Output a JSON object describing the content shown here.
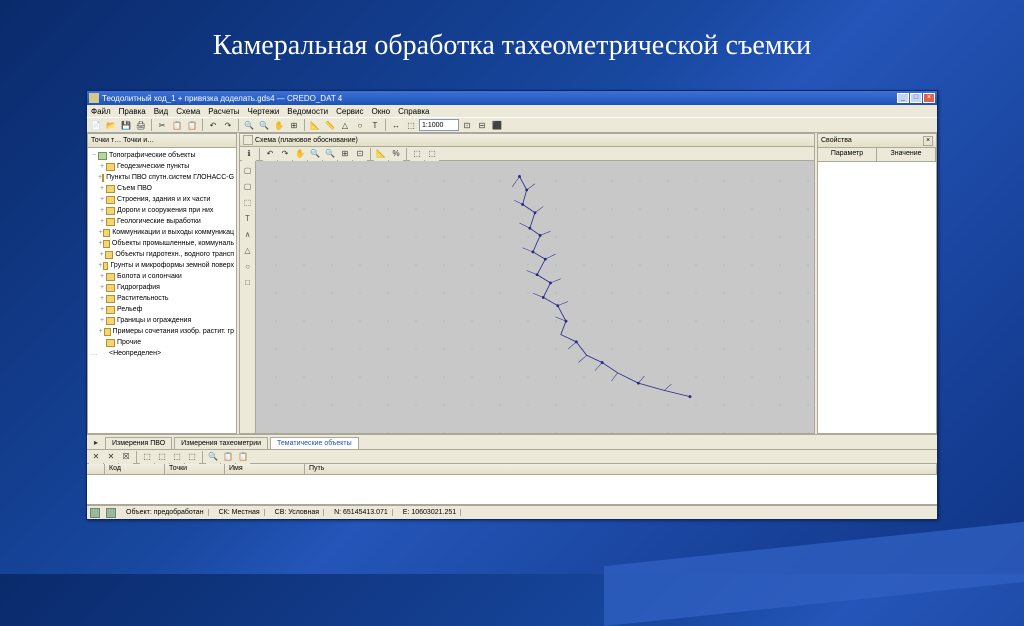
{
  "slide": {
    "title": "Камеральная обработка тахеометрической съемки"
  },
  "window": {
    "title": "Теодолитный ход_1 + привязка доделать.gds4 — CREDO_DAT 4",
    "buttons": {
      "min": "_",
      "max": "□",
      "close": "×"
    }
  },
  "menu": [
    "Файл",
    "Правка",
    "Вид",
    "Схема",
    "Расчеты",
    "Чертежи",
    "Ведомости",
    "Сервис",
    "Окно",
    "Справка"
  ],
  "toolbar": {
    "scale": "1:1000",
    "icons": [
      "📄",
      "📂",
      "💾",
      "🖨",
      "✂",
      "📋",
      "📋",
      "↶",
      "↷",
      "🔍",
      "🔍",
      "✋",
      "⊞",
      "📐",
      "📏",
      "△",
      "○",
      "T",
      "↔",
      "⬚",
      "⊡",
      "⊟",
      "⬛"
    ]
  },
  "leftPanel": {
    "title": "Точки т…   Точки и…",
    "root": "Топографические объекты",
    "items": [
      "Геодезические пункты",
      "Пункты ПВО спутн.систем ГЛОНАСС-G",
      "Съем ПВО",
      "Строения, здания и их части",
      "Дороги и сооружения при них",
      "Геологические выработки",
      "Коммуникации и выходы коммуникац",
      "Объекты промышленные, коммуналь",
      "Объекты гидротехн., водного трансп",
      "Грунты и микроформы земной поверх",
      "Болота и солончаки",
      "Гидрография",
      "Растительность",
      "Рельеф",
      "Границы и ограждения",
      "Примеры сочетания изобр. растит. гр",
      "Прочие"
    ],
    "last": "<Неопределен>"
  },
  "centerPanel": {
    "title": "Схема (плановое обоснование)",
    "toolIcons": [
      "ℹ",
      "↶",
      "↷",
      "✋",
      "🔍",
      "🔍",
      "⊞",
      "⊡",
      "📐",
      "%",
      "⬚",
      "⬚"
    ],
    "sideLabels": [
      "▢",
      "▢",
      "⬚",
      "T",
      "∧",
      "△",
      "○",
      "□"
    ]
  },
  "rightPanel": {
    "title": "Свойства",
    "col1": "Параметр",
    "col2": "Значение"
  },
  "bottomTabs": {
    "items": [
      "Измерения ПВО",
      "Измерения тахеометрии",
      "Тематические объекты"
    ],
    "activeIndex": 2
  },
  "bottomTools": [
    "✕",
    "✕",
    "☒",
    "⬚",
    "⬚",
    "⬚",
    "⬚",
    "🔍",
    "📋",
    "📋"
  ],
  "gridCols": {
    "c1": "",
    "c2": "Код",
    "c3": "Точки",
    "c4": "Имя",
    "c5": "Путь"
  },
  "status": {
    "obj": "Объект: предобработан",
    "sk": "СК: Местная",
    "sv": "СВ: Условная",
    "n": "N: 65145413.071",
    "e": "E: 10603021.251"
  }
}
